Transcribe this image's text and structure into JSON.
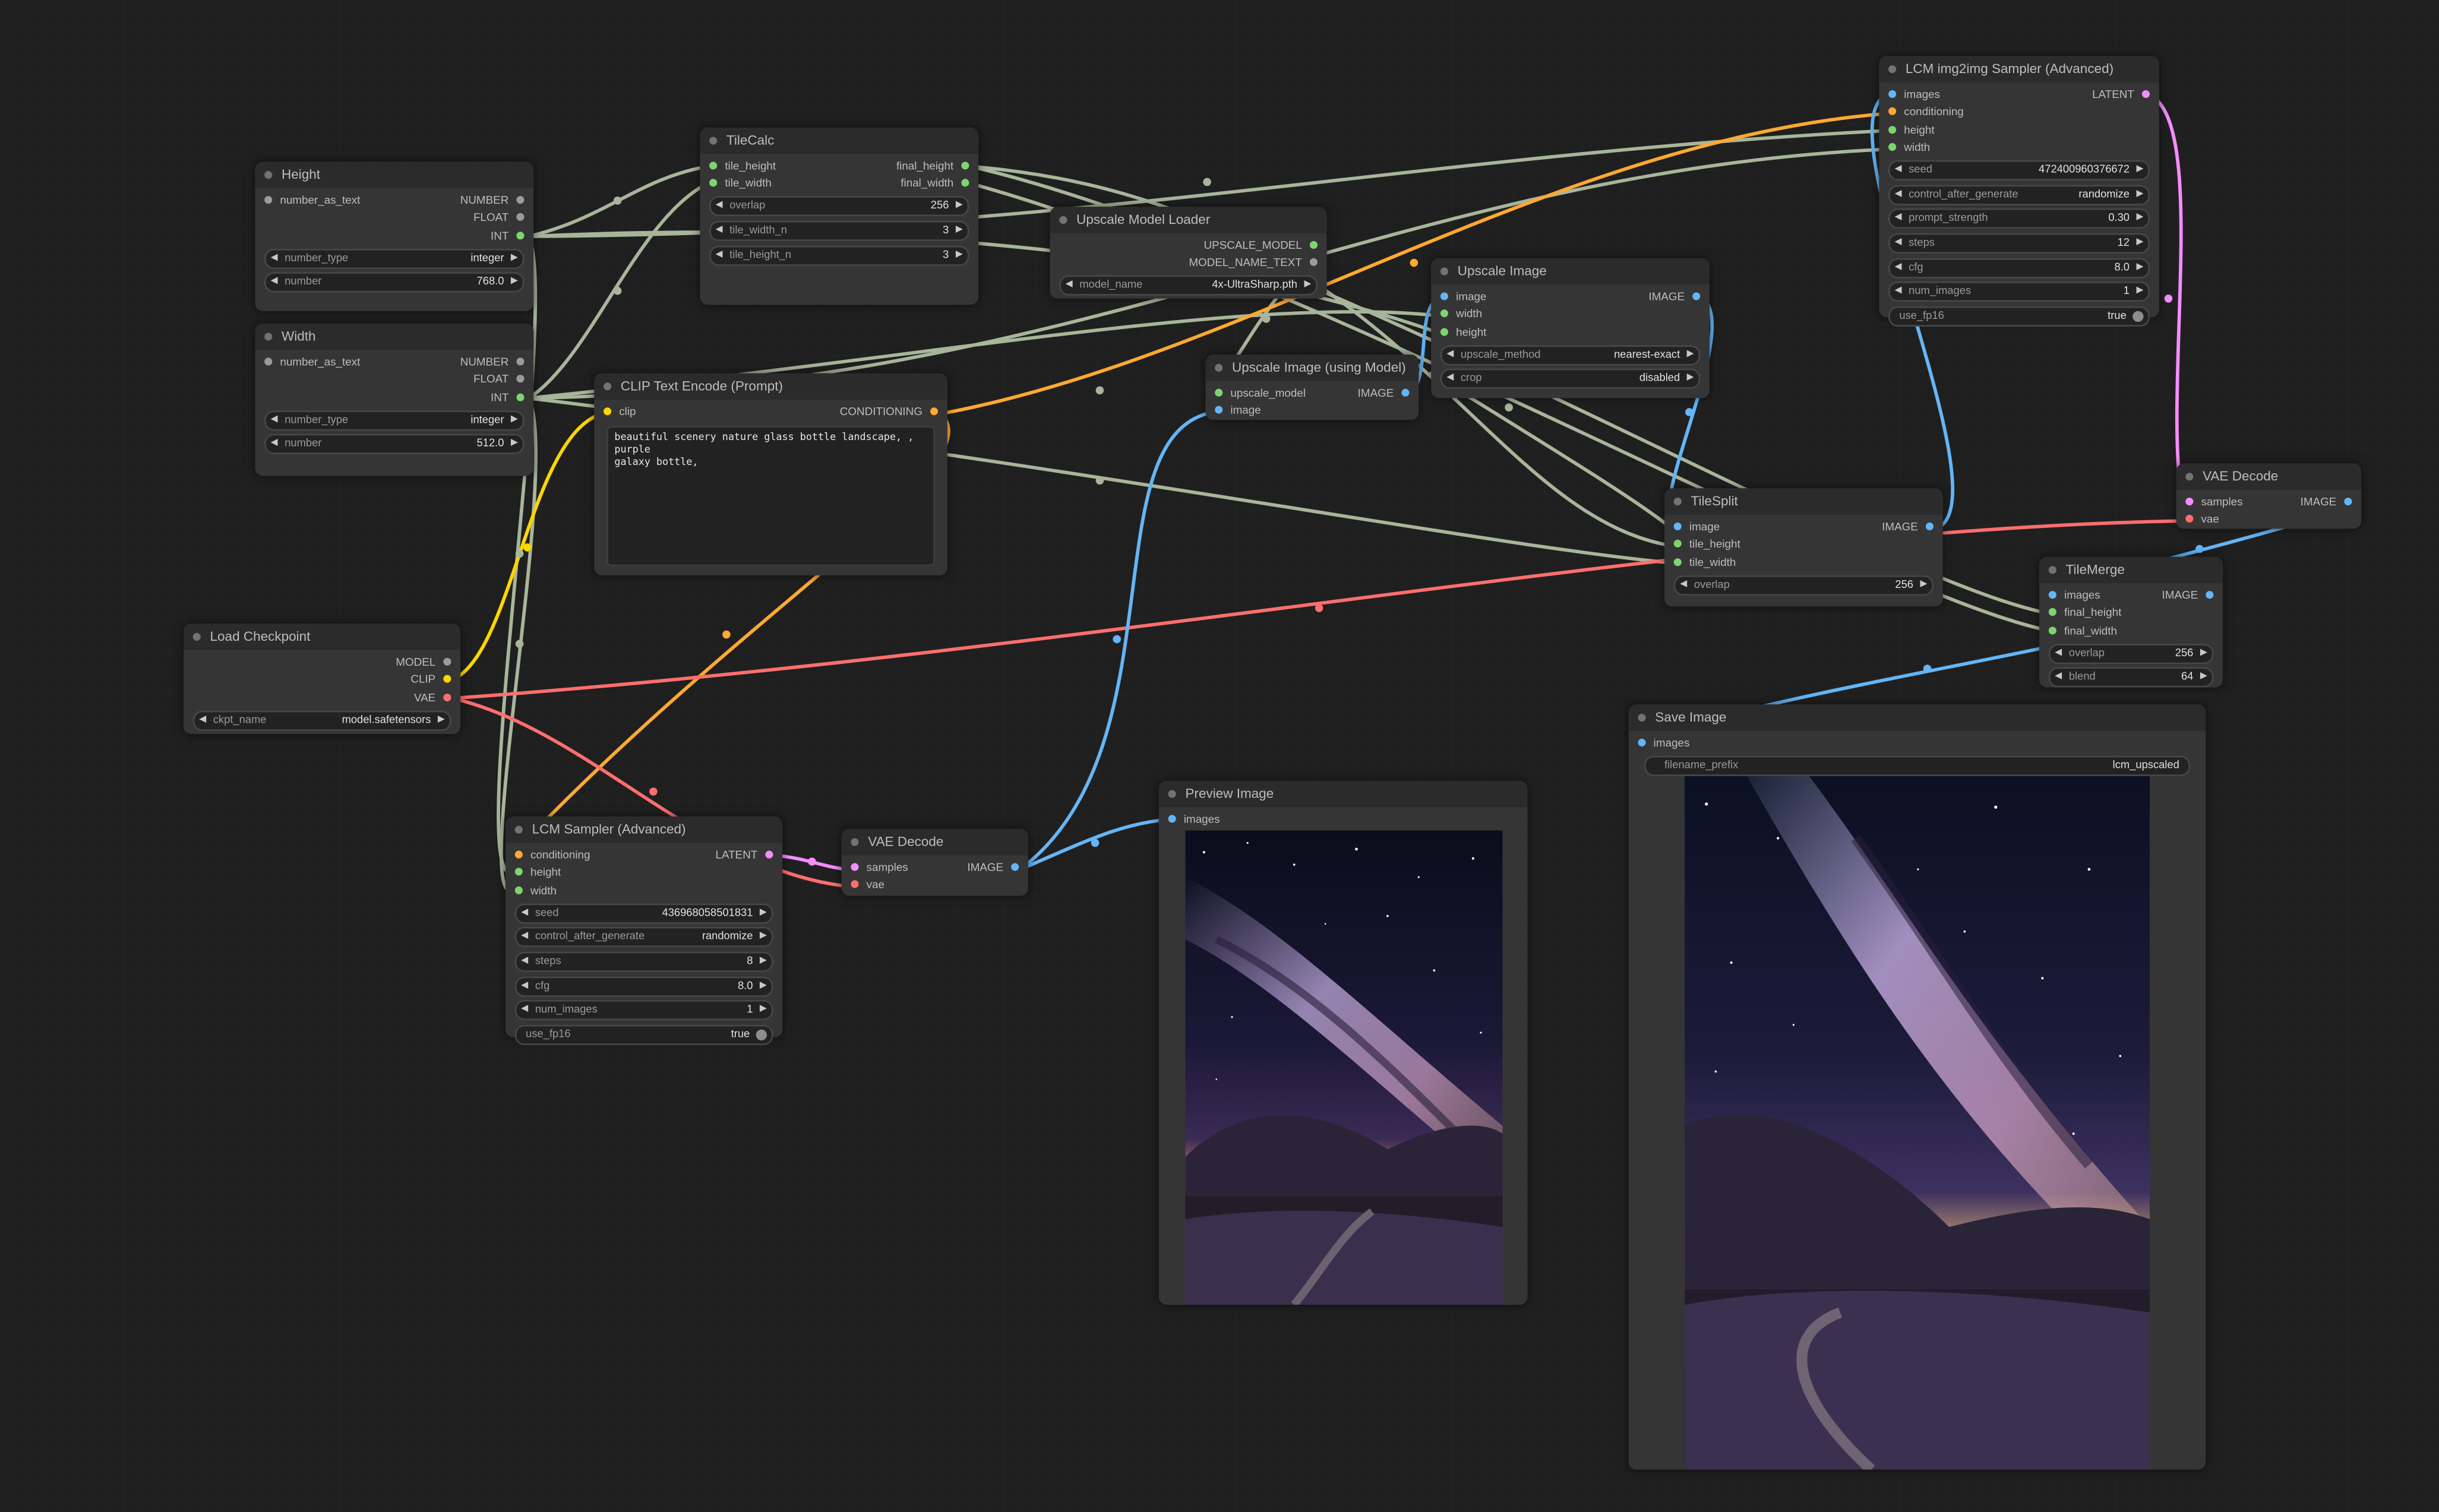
{
  "colors": {
    "background": "#1f1f1f",
    "node": "#353535",
    "image": "#64b5f6",
    "int": "#7ed56f",
    "conditioning": "#ffa931",
    "clip": "#ffd500",
    "vae": "#ff6e6e",
    "latent": "#f58cff",
    "upscale_model": "#7ed56f",
    "generic": "#a8b59a"
  },
  "nodes": {
    "height": {
      "title": "Height",
      "outputs": [
        "NUMBER",
        "FLOAT",
        "INT"
      ],
      "inputs": [
        "number_as_text"
      ],
      "widgets": [
        {
          "label": "number_type",
          "value": "integer"
        },
        {
          "label": "number",
          "value": "768.0"
        }
      ]
    },
    "width": {
      "title": "Width",
      "outputs": [
        "NUMBER",
        "FLOAT",
        "INT"
      ],
      "inputs": [
        "number_as_text"
      ],
      "widgets": [
        {
          "label": "number_type",
          "value": "integer"
        },
        {
          "label": "number",
          "value": "512.0"
        }
      ]
    },
    "tilecalc": {
      "title": "TileCalc",
      "inputs": [
        "tile_height",
        "tile_width"
      ],
      "outputs": [
        "final_height",
        "final_width"
      ],
      "widgets": [
        {
          "label": "overlap",
          "value": "256"
        },
        {
          "label": "tile_width_n",
          "value": "3"
        },
        {
          "label": "tile_height_n",
          "value": "3"
        }
      ]
    },
    "upscale_model_loader": {
      "title": "Upscale Model Loader",
      "outputs": [
        "UPSCALE_MODEL",
        "MODEL_NAME_TEXT"
      ],
      "widgets": [
        {
          "label": "model_name",
          "value": "4x-UltraSharp.pth"
        }
      ]
    },
    "clip_text_encode": {
      "title": "CLIP Text Encode (Prompt)",
      "inputs": [
        "clip"
      ],
      "outputs": [
        "CONDITIONING"
      ],
      "text": "beautiful scenery nature glass bottle landscape, , purple\ngalaxy bottle,"
    },
    "load_checkpoint": {
      "title": "Load Checkpoint",
      "outputs": [
        "MODEL",
        "CLIP",
        "VAE"
      ],
      "widgets": [
        {
          "label": "ckpt_name",
          "value": "model.safetensors"
        }
      ]
    },
    "upscale_image": {
      "title": "Upscale Image",
      "inputs": [
        "image",
        "width",
        "height"
      ],
      "outputs": [
        "IMAGE"
      ],
      "widgets": [
        {
          "label": "upscale_method",
          "value": "nearest-exact"
        },
        {
          "label": "crop",
          "value": "disabled"
        }
      ]
    },
    "upscale_image_model": {
      "title": "Upscale Image (using Model)",
      "inputs": [
        "upscale_model",
        "image"
      ],
      "outputs": [
        "IMAGE"
      ]
    },
    "lcm_img2img": {
      "title": "LCM img2img Sampler (Advanced)",
      "inputs": [
        "images",
        "conditioning",
        "height",
        "width"
      ],
      "outputs": [
        "LATENT"
      ],
      "widgets": [
        {
          "label": "seed",
          "value": "472400960376672"
        },
        {
          "label": "control_after_generate",
          "value": "randomize"
        },
        {
          "label": "prompt_strength",
          "value": "0.30"
        },
        {
          "label": "steps",
          "value": "12"
        },
        {
          "label": "cfg",
          "value": "8.0"
        },
        {
          "label": "num_images",
          "value": "1"
        }
      ],
      "toggle": {
        "label": "use_fp16",
        "value": "true"
      }
    },
    "vae_decode_right": {
      "title": "VAE Decode",
      "inputs": [
        "samples",
        "vae"
      ],
      "outputs": [
        "IMAGE"
      ]
    },
    "tilesplit": {
      "title": "TileSplit",
      "inputs": [
        "image",
        "tile_height",
        "tile_width"
      ],
      "outputs": [
        "IMAGE"
      ],
      "widgets": [
        {
          "label": "overlap",
          "value": "256"
        }
      ]
    },
    "tilemerge": {
      "title": "TileMerge",
      "inputs": [
        "images",
        "final_height",
        "final_width"
      ],
      "outputs": [
        "IMAGE"
      ],
      "widgets": [
        {
          "label": "overlap",
          "value": "256"
        },
        {
          "label": "blend",
          "value": "64"
        }
      ]
    },
    "lcm_sampler": {
      "title": "LCM Sampler (Advanced)",
      "inputs": [
        "conditioning",
        "height",
        "width"
      ],
      "outputs": [
        "LATENT"
      ],
      "widgets": [
        {
          "label": "seed",
          "value": "436968058501831"
        },
        {
          "label": "control_after_generate",
          "value": "randomize"
        },
        {
          "label": "steps",
          "value": "8"
        },
        {
          "label": "cfg",
          "value": "8.0"
        },
        {
          "label": "num_images",
          "value": "1"
        }
      ],
      "toggle": {
        "label": "use_fp16",
        "value": "true"
      }
    },
    "vae_decode_mid": {
      "title": "VAE Decode",
      "inputs": [
        "samples",
        "vae"
      ],
      "outputs": [
        "IMAGE"
      ]
    },
    "preview_image": {
      "title": "Preview Image",
      "inputs": [
        "images"
      ]
    },
    "save_image": {
      "title": "Save Image",
      "inputs": [
        "images"
      ],
      "widgets": [
        {
          "label": "filename_prefix",
          "value": "lcm_upscaled"
        }
      ]
    }
  }
}
